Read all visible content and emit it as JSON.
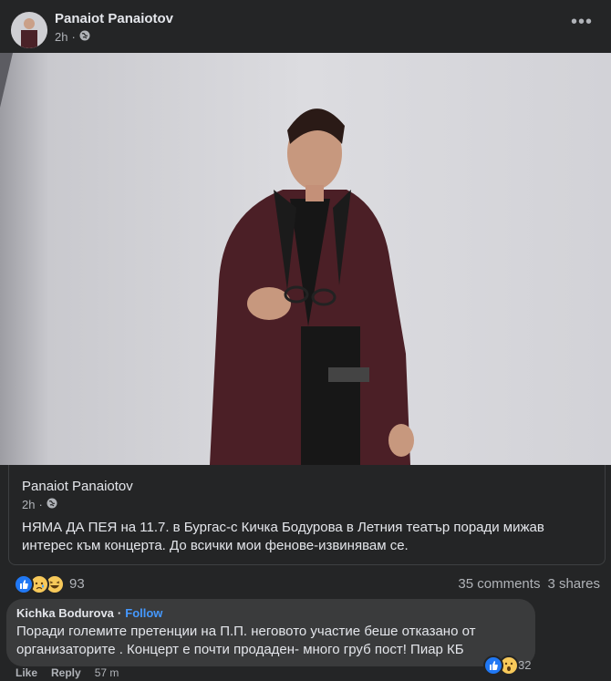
{
  "post": {
    "author": "Panaiot Panaiotov",
    "time": "2h",
    "privacy_icon": "globe-icon",
    "more_icon": "more-options-icon"
  },
  "shared": {
    "author": "Panaiot Panaiotov",
    "time": "2h",
    "text": "НЯМА ДА ПЕЯ на 11.7. в Бургас-с Кичка Бодурова в Летния театър поради мижав интерес към концерта. До всички мои фенове-извинявам се."
  },
  "reactions": {
    "icons": [
      "like-icon",
      "sad-icon",
      "haha-icon"
    ],
    "count": "93",
    "comments": "35 comments",
    "shares": "3 shares"
  },
  "comment": {
    "author": "Kichka Bodurova",
    "separator": "·",
    "follow": "Follow",
    "text": "Поради големите претенции на П.П. неговото участие беше отказано от организаторите . Концерт е почти продаден- много груб пост! Пиар КБ",
    "reaction_icons": [
      "like-icon",
      "wow-icon"
    ],
    "reaction_count": "32",
    "like": "Like",
    "reply": "Reply",
    "time": "57 m"
  },
  "colors": {
    "background": "#242526",
    "bubble": "#3a3b3c",
    "link": "#4599ff",
    "like_blue": "#2078f4"
  }
}
